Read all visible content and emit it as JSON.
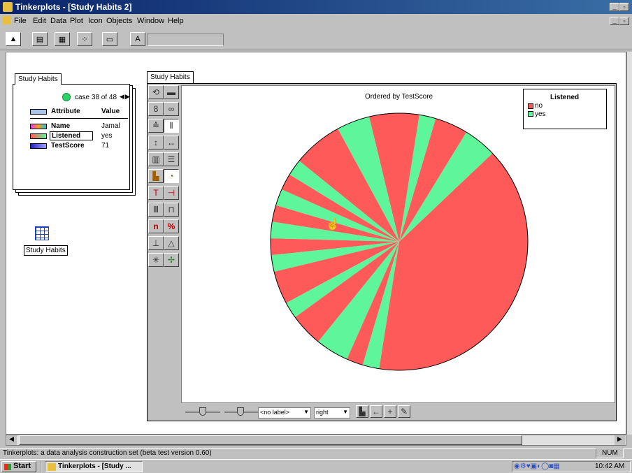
{
  "window": {
    "title": "Tinkerplots - [Study Habits 2]"
  },
  "menu": [
    "File",
    "Edit",
    "Data",
    "Plot",
    "Icon",
    "Objects",
    "Window",
    "Help"
  ],
  "toolbar_icons": [
    "pointer-icon",
    "text-icon",
    "table-icon",
    "plot-icon",
    "slider-icon",
    "label-icon"
  ],
  "card": {
    "tab": "Study Habits",
    "case_label": "case 38 of 48",
    "header_attribute": "Attribute",
    "header_value": "Value",
    "rows": [
      {
        "attribute": "Name",
        "value": "Jamal",
        "color": "#c040c0"
      },
      {
        "attribute": "Listened",
        "value": "yes",
        "color": "#60e090"
      },
      {
        "attribute": "TestScore",
        "value": "71",
        "color": "#2020c0"
      }
    ]
  },
  "desktop_icon": {
    "label": "Study Habits"
  },
  "plot": {
    "tab": "Study Habits",
    "heading": "Ordered by TestScore",
    "colors": {
      "no": "#ff5a5a",
      "yes": "#5ff59a"
    },
    "legend": {
      "title": "Listened",
      "items": [
        {
          "label": "no",
          "color": "#ff5a5a"
        },
        {
          "label": "yes",
          "color": "#5ff59a"
        }
      ]
    },
    "bottom": {
      "label_select": "<no label>",
      "position_select": "right"
    }
  },
  "chart_data": {
    "type": "pie",
    "title": "Ordered by TestScore",
    "legend": {
      "title": "Listened",
      "placement": "top-right"
    },
    "categories": [
      "no",
      "yes"
    ],
    "values": [
      35,
      13
    ],
    "slices": [
      {
        "label": "no",
        "value": 19
      },
      {
        "label": "yes",
        "value": 2
      },
      {
        "label": "no",
        "value": 2
      },
      {
        "label": "yes",
        "value": 1
      },
      {
        "label": "no",
        "value": 3
      },
      {
        "label": "yes",
        "value": 2
      },
      {
        "label": "no",
        "value": 3
      },
      {
        "label": "yes",
        "value": 1
      },
      {
        "label": "no",
        "value": 1
      },
      {
        "label": "yes",
        "value": 1
      },
      {
        "label": "no",
        "value": 1
      },
      {
        "label": "yes",
        "value": 1
      },
      {
        "label": "no",
        "value": 1
      },
      {
        "label": "yes",
        "value": 1
      },
      {
        "label": "no",
        "value": 2
      },
      {
        "label": "yes",
        "value": 1
      },
      {
        "label": "no",
        "value": 2
      },
      {
        "label": "yes",
        "value": 2
      },
      {
        "label": "no",
        "value": 1
      },
      {
        "label": "yes",
        "value": 1
      }
    ]
  },
  "status": {
    "text": "Tinkerplots: a data analysis construction set (beta test version 0.60)",
    "num": "NUM"
  },
  "taskbar": {
    "start": "Start",
    "task": "Tinkerplots - [Study ...",
    "clock": "10:42 AM"
  }
}
